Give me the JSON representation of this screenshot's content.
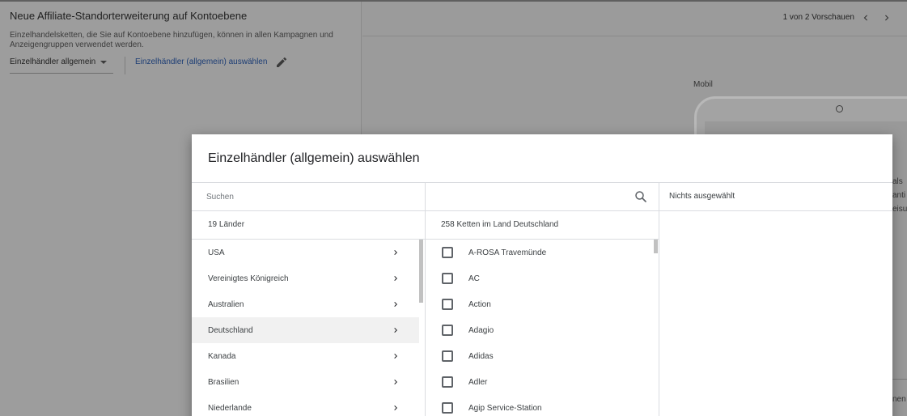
{
  "background": {
    "title": "Neue Affiliate-Standorterweiterung auf Kontoebene",
    "description": "Einzelhandelsketten, die Sie auf Kontoebene hinzufügen, können in allen Kampagnen und Anzeigengruppen verwendet werden.",
    "select_value": "Einzelhändler allgemein",
    "select_link": "Einzelhändler (allgemein) auswählen",
    "pager": "1 von 2 Vorschauen",
    "device_label": "Mobil",
    "peek_text_1": "als",
    "peek_text_2": "anti",
    "peek_text_3": "eisu",
    "peek_text_4": "nen"
  },
  "modal": {
    "title": "Einzelhändler (allgemein) auswählen",
    "search_placeholder": "Suchen",
    "selected_summary": "Nichts ausgewählt",
    "countries_header": "19 Länder",
    "chains_header": "258 Ketten im Land Deutschland",
    "countries": [
      {
        "label": "USA"
      },
      {
        "label": "Vereinigtes Königreich"
      },
      {
        "label": "Australien"
      },
      {
        "label": "Deutschland"
      },
      {
        "label": "Kanada"
      },
      {
        "label": "Brasilien"
      },
      {
        "label": "Niederlande"
      }
    ],
    "chains": [
      {
        "label": "A-ROSA Travemünde"
      },
      {
        "label": "AC"
      },
      {
        "label": "Action"
      },
      {
        "label": "Adagio"
      },
      {
        "label": "Adidas"
      },
      {
        "label": "Adler"
      },
      {
        "label": "Agip Service-Station"
      }
    ]
  },
  "icons": {
    "search": "search-icon",
    "chevron": "chevron-right-icon",
    "pencil": "pencil-icon"
  },
  "colors": {
    "link": "#1c3d75",
    "active_row": "#f1f1f1",
    "divider": "#dadce0"
  }
}
